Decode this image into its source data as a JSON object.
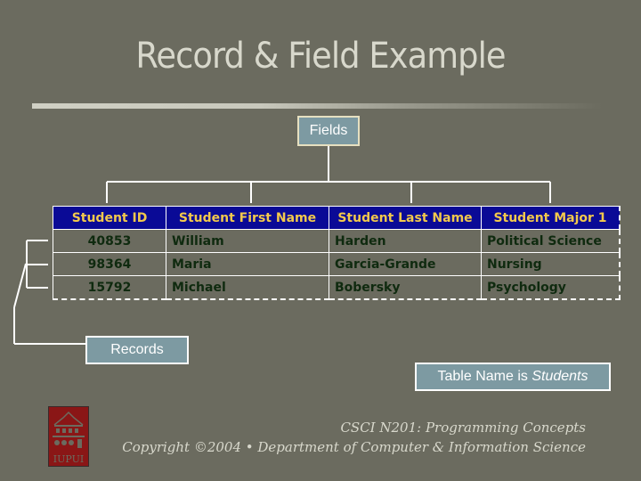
{
  "slide": {
    "title": "Record & Field Example",
    "labels": {
      "fields": "Fields",
      "records": "Records",
      "table_name_prefix": "Table Name is ",
      "table_name": "Students"
    },
    "table": {
      "columns": [
        "Student ID",
        "Student First Name",
        "Student Last Name",
        "Student Major 1"
      ],
      "rows": [
        [
          "40853",
          "William",
          "Harden",
          "Political Science"
        ],
        [
          "98364",
          "Maria",
          "Garcia-Grande",
          "Nursing"
        ],
        [
          "15792",
          "Michael",
          "Bobersky",
          "Psychology"
        ]
      ]
    },
    "footer": {
      "line1": "CSCI N201: Programming Concepts",
      "line2": "Copyright ©2004 • Department of Computer & Information Science"
    },
    "logo": {
      "text": "IUPUI",
      "icon": "iupui-logo-icon"
    },
    "colors": {
      "background": "#6b6b5f",
      "header_bg": "#0a0a96",
      "header_text": "#f2c94c",
      "cell_text": "#0f2a0f",
      "label_box": "#7d9aa2"
    }
  }
}
